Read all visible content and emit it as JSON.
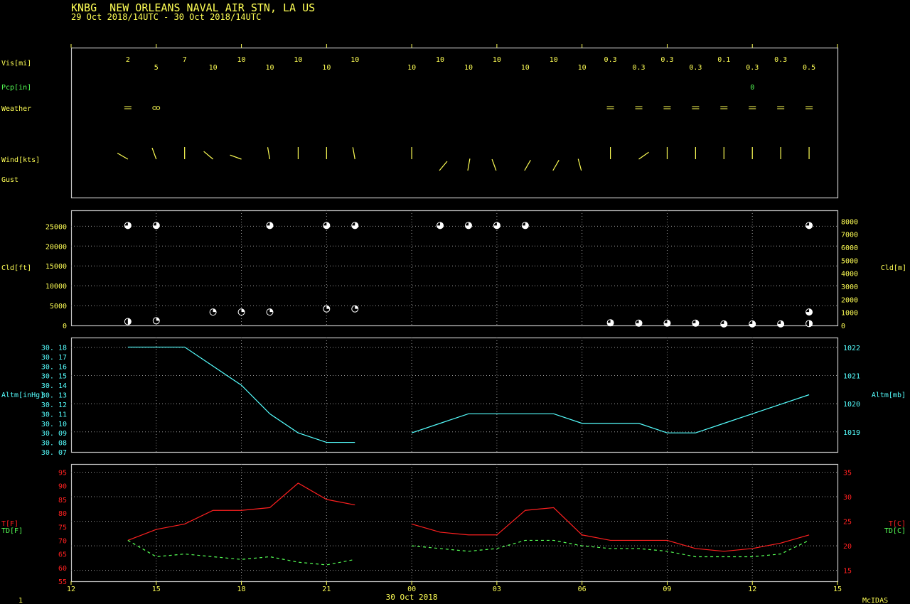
{
  "header": {
    "title": "KNBG  NEW ORLEANS NAVAL AIR STN, LA US",
    "range": "29 Oct 2018/14UTC - 30 Oct 2018/14UTC"
  },
  "footer": {
    "page": "1",
    "brand": "McIDAS",
    "date_label": "30 Oct 2018"
  },
  "colors": {
    "yellow": "#ffff55",
    "green": "#55ff55",
    "cyan": "#55ffff",
    "red": "#ff2020",
    "frame": "#c8c8c8"
  },
  "time_axis": {
    "x_range": [
      12,
      39
    ],
    "ticks": [
      12,
      15,
      18,
      21,
      24,
      27,
      30,
      33,
      36,
      39
    ],
    "tick_labels": [
      "12",
      "15",
      "18",
      "21",
      "00",
      "03",
      "06",
      "09",
      "12",
      "15"
    ]
  },
  "panel1_labels": {
    "vis": "Vis[mi]",
    "pcp": "Pcp[in]",
    "weather": "Weather",
    "wind": "Wind[kts]",
    "gust": "Gust"
  },
  "visibility": [
    {
      "t": 14,
      "v": "2"
    },
    {
      "t": 15,
      "v": "5"
    },
    {
      "t": 16,
      "v": "7"
    },
    {
      "t": 17,
      "v": "10"
    },
    {
      "t": 18,
      "v": "10"
    },
    {
      "t": 19,
      "v": "10"
    },
    {
      "t": 20,
      "v": "10"
    },
    {
      "t": 21,
      "v": "10"
    },
    {
      "t": 22,
      "v": "10"
    },
    {
      "t": 24,
      "v": "10"
    },
    {
      "t": 25,
      "v": "10"
    },
    {
      "t": 26,
      "v": "10"
    },
    {
      "t": 27,
      "v": "10"
    },
    {
      "t": 28,
      "v": "10"
    },
    {
      "t": 29,
      "v": "10"
    },
    {
      "t": 30,
      "v": "10"
    },
    {
      "t": 31,
      "v": "0.3"
    },
    {
      "t": 32,
      "v": "0.3"
    },
    {
      "t": 33,
      "v": "0.3"
    },
    {
      "t": 34,
      "v": "0.3"
    },
    {
      "t": 35,
      "v": "0.1"
    },
    {
      "t": 36,
      "v": "0.3"
    },
    {
      "t": 37,
      "v": "0.3"
    },
    {
      "t": 38,
      "v": "0.5"
    }
  ],
  "precipitation": [
    {
      "t": 36,
      "v": "0"
    }
  ],
  "weather": [
    {
      "t": 14,
      "sym": "fog"
    },
    {
      "t": 15,
      "sym": "haze"
    },
    {
      "t": 31,
      "sym": "fog"
    },
    {
      "t": 32,
      "sym": "fog"
    },
    {
      "t": 33,
      "sym": "fog"
    },
    {
      "t": 34,
      "sym": "fog"
    },
    {
      "t": 35,
      "sym": "fog"
    },
    {
      "t": 36,
      "sym": "fog"
    },
    {
      "t": 37,
      "sym": "fog"
    },
    {
      "t": 38,
      "sym": "fog"
    }
  ],
  "wind_direction_deg": [
    {
      "t": 14,
      "dir": 300
    },
    {
      "t": 15,
      "dir": 340
    },
    {
      "t": 16,
      "dir": 360
    },
    {
      "t": 17,
      "dir": 310
    },
    {
      "t": 18,
      "dir": 290
    },
    {
      "t": 19,
      "dir": 350
    },
    {
      "t": 20,
      "dir": 360
    },
    {
      "t": 21,
      "dir": 360
    },
    {
      "t": 22,
      "dir": 350
    },
    {
      "t": 24,
      "dir": 360
    },
    {
      "t": 25,
      "dir": 40
    },
    {
      "t": 26,
      "dir": 10
    },
    {
      "t": 27,
      "dir": 340
    },
    {
      "t": 28,
      "dir": 30
    },
    {
      "t": 29,
      "dir": 30
    },
    {
      "t": 30,
      "dir": 345
    },
    {
      "t": 31,
      "dir": 360
    },
    {
      "t": 32,
      "dir": 55
    },
    {
      "t": 33,
      "dir": 360
    },
    {
      "t": 34,
      "dir": 360
    },
    {
      "t": 35,
      "dir": 360
    },
    {
      "t": 36,
      "dir": 360
    },
    {
      "t": 37,
      "dir": 360
    },
    {
      "t": 38,
      "dir": 360
    }
  ],
  "chart_data": [
    {
      "type": "scatter",
      "panel": "cloud",
      "ylabel_left": "Cld[ft]",
      "ylabel_right": "Cld[m]",
      "ylim": [
        0,
        29000
      ],
      "yticks_left": [
        0,
        5000,
        10000,
        15000,
        20000,
        25000
      ],
      "ylim_right": [
        0,
        9000
      ],
      "yticks_right": [
        0,
        1000,
        2000,
        3000,
        4000,
        5000,
        6000,
        7000,
        8000,
        9000
      ],
      "grid": true,
      "points": [
        {
          "t": 14,
          "ft": 25000,
          "cover": 0.75
        },
        {
          "t": 14,
          "ft": 800,
          "cover": 0.5
        },
        {
          "t": 15,
          "ft": 25000,
          "cover": 0.75
        },
        {
          "t": 15,
          "ft": 1000,
          "cover": 0.25
        },
        {
          "t": 17,
          "ft": 3200,
          "cover": 0.25
        },
        {
          "t": 18,
          "ft": 3200,
          "cover": 0.25
        },
        {
          "t": 19,
          "ft": 25000,
          "cover": 0.75
        },
        {
          "t": 19,
          "ft": 3200,
          "cover": 0.25
        },
        {
          "t": 21,
          "ft": 25000,
          "cover": 0.75
        },
        {
          "t": 21,
          "ft": 4000,
          "cover": 0.25
        },
        {
          "t": 22,
          "ft": 25000,
          "cover": 0.75
        },
        {
          "t": 22,
          "ft": 4000,
          "cover": 0.25
        },
        {
          "t": 25,
          "ft": 25000,
          "cover": 0.75
        },
        {
          "t": 26,
          "ft": 25000,
          "cover": 0.75
        },
        {
          "t": 27,
          "ft": 25000,
          "cover": 0.75
        },
        {
          "t": 28,
          "ft": 25000,
          "cover": 0.75
        },
        {
          "t": 31,
          "ft": 500,
          "cover": 0.75
        },
        {
          "t": 32,
          "ft": 400,
          "cover": 0.75
        },
        {
          "t": 33,
          "ft": 400,
          "cover": 0.75
        },
        {
          "t": 34,
          "ft": 400,
          "cover": 0.75
        },
        {
          "t": 35,
          "ft": 200,
          "cover": 0.75
        },
        {
          "t": 36,
          "ft": 200,
          "cover": 0.75
        },
        {
          "t": 37,
          "ft": 200,
          "cover": 0.75
        },
        {
          "t": 38,
          "ft": 25000,
          "cover": 0.75
        },
        {
          "t": 38,
          "ft": 3200,
          "cover": 0.75
        },
        {
          "t": 38,
          "ft": 300,
          "cover": 0.5
        }
      ]
    },
    {
      "type": "line",
      "panel": "altimeter",
      "ylabel_left": "Altm[inHg]",
      "ylabel_right": "Altm[mb]",
      "ylim": [
        30.07,
        30.19
      ],
      "yticks_left": [
        30.07,
        30.08,
        30.09,
        30.1,
        30.11,
        30.12,
        30.13,
        30.14,
        30.15,
        30.16,
        30.17,
        30.18
      ],
      "yticks_right": [
        1019,
        1020,
        1021,
        1022
      ],
      "grid": true,
      "series": [
        {
          "segments": [
            [
              [
                14,
                30.18
              ],
              [
                15,
                30.18
              ],
              [
                16,
                30.18
              ],
              [
                17,
                30.16
              ],
              [
                18,
                30.14
              ],
              [
                19,
                30.11
              ],
              [
                20,
                30.09
              ],
              [
                21,
                30.08
              ],
              [
                22,
                30.08
              ]
            ],
            [
              [
                24,
                30.09
              ],
              [
                25,
                30.1
              ],
              [
                26,
                30.11
              ],
              [
                27,
                30.11
              ],
              [
                28,
                30.11
              ],
              [
                29,
                30.11
              ],
              [
                30,
                30.1
              ],
              [
                31,
                30.1
              ],
              [
                32,
                30.1
              ],
              [
                33,
                30.09
              ],
              [
                34,
                30.09
              ],
              [
                35,
                30.1
              ],
              [
                36,
                30.11
              ],
              [
                37,
                30.12
              ],
              [
                38,
                30.13
              ]
            ]
          ]
        }
      ]
    },
    {
      "type": "line",
      "panel": "temperature",
      "ylabel_left": [
        "T[F]",
        "TD[F]"
      ],
      "ylabel_right": [
        "T[C]",
        "TD[C]"
      ],
      "ylim": [
        55,
        98
      ],
      "yticks_left": [
        55,
        60,
        65,
        70,
        75,
        80,
        85,
        90,
        95
      ],
      "yticks_right": [
        15,
        20,
        25,
        30,
        35
      ],
      "grid": true,
      "series": [
        {
          "name": "T[F]",
          "segments": [
            [
              [
                14,
                70
              ],
              [
                15,
                74
              ],
              [
                16,
                76
              ],
              [
                17,
                81
              ],
              [
                18,
                81
              ],
              [
                19,
                82
              ],
              [
                20,
                91
              ],
              [
                21,
                85
              ],
              [
                22,
                83
              ]
            ],
            [
              [
                24,
                76
              ],
              [
                25,
                73
              ],
              [
                26,
                72
              ],
              [
                27,
                72
              ],
              [
                28,
                81
              ],
              [
                29,
                82
              ],
              [
                30,
                72
              ],
              [
                31,
                70
              ],
              [
                32,
                70
              ],
              [
                33,
                70
              ],
              [
                34,
                67
              ],
              [
                35,
                66
              ],
              [
                36,
                67
              ],
              [
                37,
                69
              ],
              [
                38,
                72
              ]
            ]
          ]
        },
        {
          "name": "TD[F]",
          "segments": [
            [
              [
                14,
                70
              ],
              [
                15,
                64
              ],
              [
                16,
                65
              ],
              [
                17,
                64
              ],
              [
                18,
                63
              ],
              [
                19,
                64
              ],
              [
                20,
                62
              ],
              [
                21,
                61
              ],
              [
                22,
                63
              ]
            ],
            [
              [
                24,
                68
              ],
              [
                25,
                67
              ],
              [
                26,
                66
              ],
              [
                27,
                67
              ],
              [
                28,
                70
              ],
              [
                29,
                70
              ],
              [
                30,
                68
              ],
              [
                31,
                67
              ],
              [
                32,
                67
              ],
              [
                33,
                66
              ],
              [
                34,
                64
              ],
              [
                35,
                64
              ],
              [
                36,
                64
              ],
              [
                37,
                65
              ],
              [
                38,
                70
              ]
            ]
          ]
        }
      ]
    }
  ]
}
